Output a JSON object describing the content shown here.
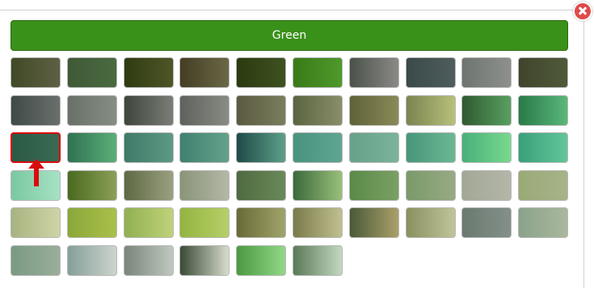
{
  "header": {
    "label": "Green"
  },
  "close_icon": "close-x-icon",
  "selected_index": 20,
  "swatches": [
    [
      "#3f4a26",
      "#5f6044"
    ],
    [
      "#3e5a36",
      "#4a6a40"
    ],
    [
      "#2f3b10",
      "#4f5628"
    ],
    [
      "#443d23",
      "#6a6846"
    ],
    [
      "#2a3a10",
      "#3f5220"
    ],
    [
      "#3a7a18",
      "#4e9a2a"
    ],
    [
      "#4a524a",
      "#8a8a86"
    ],
    [
      "#3a4a48",
      "#4f5e5c"
    ],
    [
      "#6e7570",
      "#8d908d"
    ],
    [
      "#3f452c",
      "#505a38"
    ],
    [
      "#3f4a48",
      "#6a706c"
    ],
    [
      "#687068",
      "#868e84"
    ],
    [
      "#3f453c",
      "#7a7e76"
    ],
    [
      "#5e625c",
      "#888c84"
    ],
    [
      "#5a5a40",
      "#7a7e5e"
    ],
    [
      "#5a6440",
      "#8a8e6a"
    ],
    [
      "#5f6238",
      "#8a8a58"
    ],
    [
      "#7a8450",
      "#b8c07a"
    ],
    [
      "#2f5a30",
      "#58a060"
    ],
    [
      "#287a48",
      "#5ab87a"
    ],
    [
      "#2a5a44",
      "#3a6a54"
    ],
    [
      "#2f7252",
      "#5ab078"
    ],
    [
      "#3f7a68",
      "#5c9a84"
    ],
    [
      "#3f8070",
      "#64a28a"
    ],
    [
      "#1e4a48",
      "#5ea08a"
    ],
    [
      "#48947e",
      "#60a492"
    ],
    [
      "#68a08a",
      "#7ab49a"
    ],
    [
      "#48967a",
      "#6ab892"
    ],
    [
      "#48b07a",
      "#78d88e"
    ],
    [
      "#3aa07a",
      "#62c69a"
    ],
    [
      "#7ac8a2",
      "#a6e2c4"
    ],
    [
      "#4a6a20",
      "#8aa056"
    ],
    [
      "#5e6a44",
      "#9aa080"
    ],
    [
      "#8a9478",
      "#b4b8a6"
    ],
    [
      "#4f6a40",
      "#6a8a5a"
    ],
    [
      "#3a6a3a",
      "#9ac07a"
    ],
    [
      "#5a8a48",
      "#7aa064"
    ],
    [
      "#7a9a6a",
      "#98aa84"
    ],
    [
      "#a2a896",
      "#b4b6a8"
    ],
    [
      "#9aaa76",
      "#a6b488"
    ],
    [
      "#a6b480",
      "#d0d4a6"
    ],
    [
      "#8aa83a",
      "#aac04a"
    ],
    [
      "#90b050",
      "#c0d27a"
    ],
    [
      "#94b440",
      "#b6d068"
    ],
    [
      "#6a6a38",
      "#a0a46a"
    ],
    [
      "#7a7a4a",
      "#c0c090"
    ],
    [
      "#4a5a38",
      "#aaa06a"
    ],
    [
      "#8a9060",
      "#c0c49a"
    ],
    [
      "#6a7a70",
      "#84908a"
    ],
    [
      "#8aa28a",
      "#aab89e"
    ],
    [
      "#7a9a84",
      "#9aae9a"
    ],
    [
      "#84a09a",
      "#cdd4cc"
    ],
    [
      "#7a867a",
      "#c0c8c0"
    ],
    [
      "#3a4a36",
      "#d8dccc"
    ],
    [
      "#4a9a40",
      "#92d888"
    ],
    [
      "#5a7a58",
      "#c2d8c0"
    ]
  ]
}
